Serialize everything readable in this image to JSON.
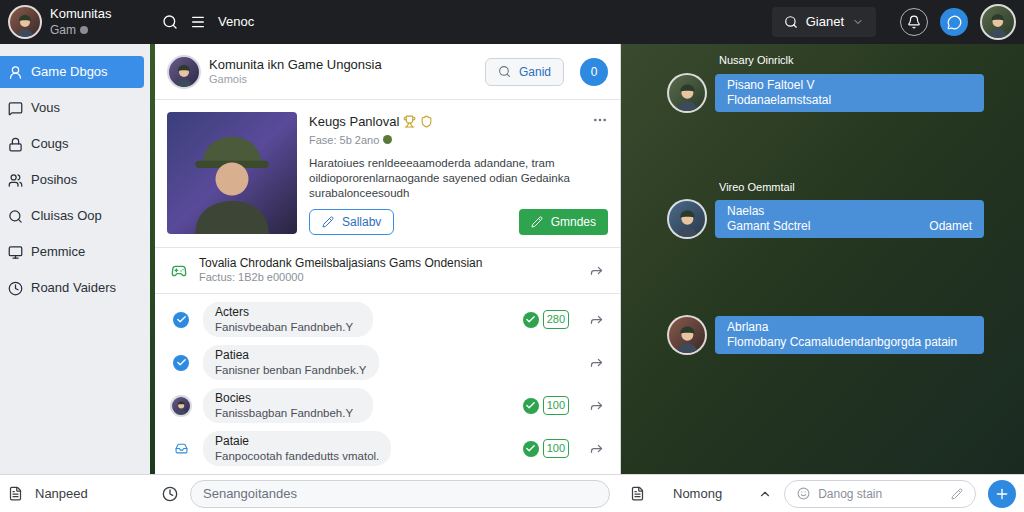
{
  "app": {
    "title": "Komunitas",
    "subtitle": "Gam"
  },
  "topbar": {
    "menu_label": "Venoc",
    "search": {
      "placeholder": "Gianet"
    }
  },
  "sidebar": {
    "items": [
      {
        "label": "Game Dbgos",
        "selected": true
      },
      {
        "label": "Vous",
        "selected": false
      },
      {
        "label": "Cougs",
        "selected": false
      },
      {
        "label": "Posihos",
        "selected": false
      },
      {
        "label": "Cluisas Oop",
        "selected": false
      },
      {
        "label": "Pemmice",
        "selected": false
      },
      {
        "label": "Roand Vaiders",
        "selected": false
      }
    ]
  },
  "group": {
    "title": "Komunita ikn Game Ungonsia",
    "subtitle": "Gamois",
    "search_button": "Ganid",
    "count": "0"
  },
  "post": {
    "title": "Keugs Panloval",
    "meta": "Fase: 5b 2ano",
    "description": "Haratoiues renldeeeaamoderda adandane, tram oildiopororenlarnaogande sayened odian Gedainka surabalonceesoudh",
    "secondary_button": "Sallabv",
    "primary_button": "Gmndes"
  },
  "thread": {
    "title": "Tovalia Chrodank Gmeilsbaljasians Gams Ondensian",
    "meta": "Factus: 1B2b e00000"
  },
  "replies": [
    {
      "name": "Acters",
      "text": "Fanisvbeaban Fandnbeh.Y",
      "count": "280",
      "kind": "check"
    },
    {
      "name": "Patiea",
      "text": "Fanisner benban Fandnbek.Y",
      "kind": "check"
    },
    {
      "name": "Bocies",
      "text": "Fanissbagban Fandnbeh.Y",
      "count": "100",
      "kind": "avatar"
    },
    {
      "name": "Pataie",
      "text": "Fanpocootah fandedutts vmatol.",
      "count": "100",
      "kind": "badge"
    }
  ],
  "chat": [
    {
      "label": "Nusary Oinriclk",
      "name": "Pisano Faltoel V",
      "text": "Flodanaelamstsatal"
    },
    {
      "label": "Vireo Oemmtail",
      "name": "Naelas",
      "text": "Gamant Sdctrel",
      "time": "Odamet"
    },
    {
      "name": "Abrlana",
      "text": "Flomobany Ccamaludendanbgorgda patain"
    }
  ],
  "bottom_bar": {
    "left_label": "Nanpeed",
    "input_placeholder": "Senangoitandes",
    "middle_label": "Nomong",
    "field_placeholder": "Danog stain"
  }
}
